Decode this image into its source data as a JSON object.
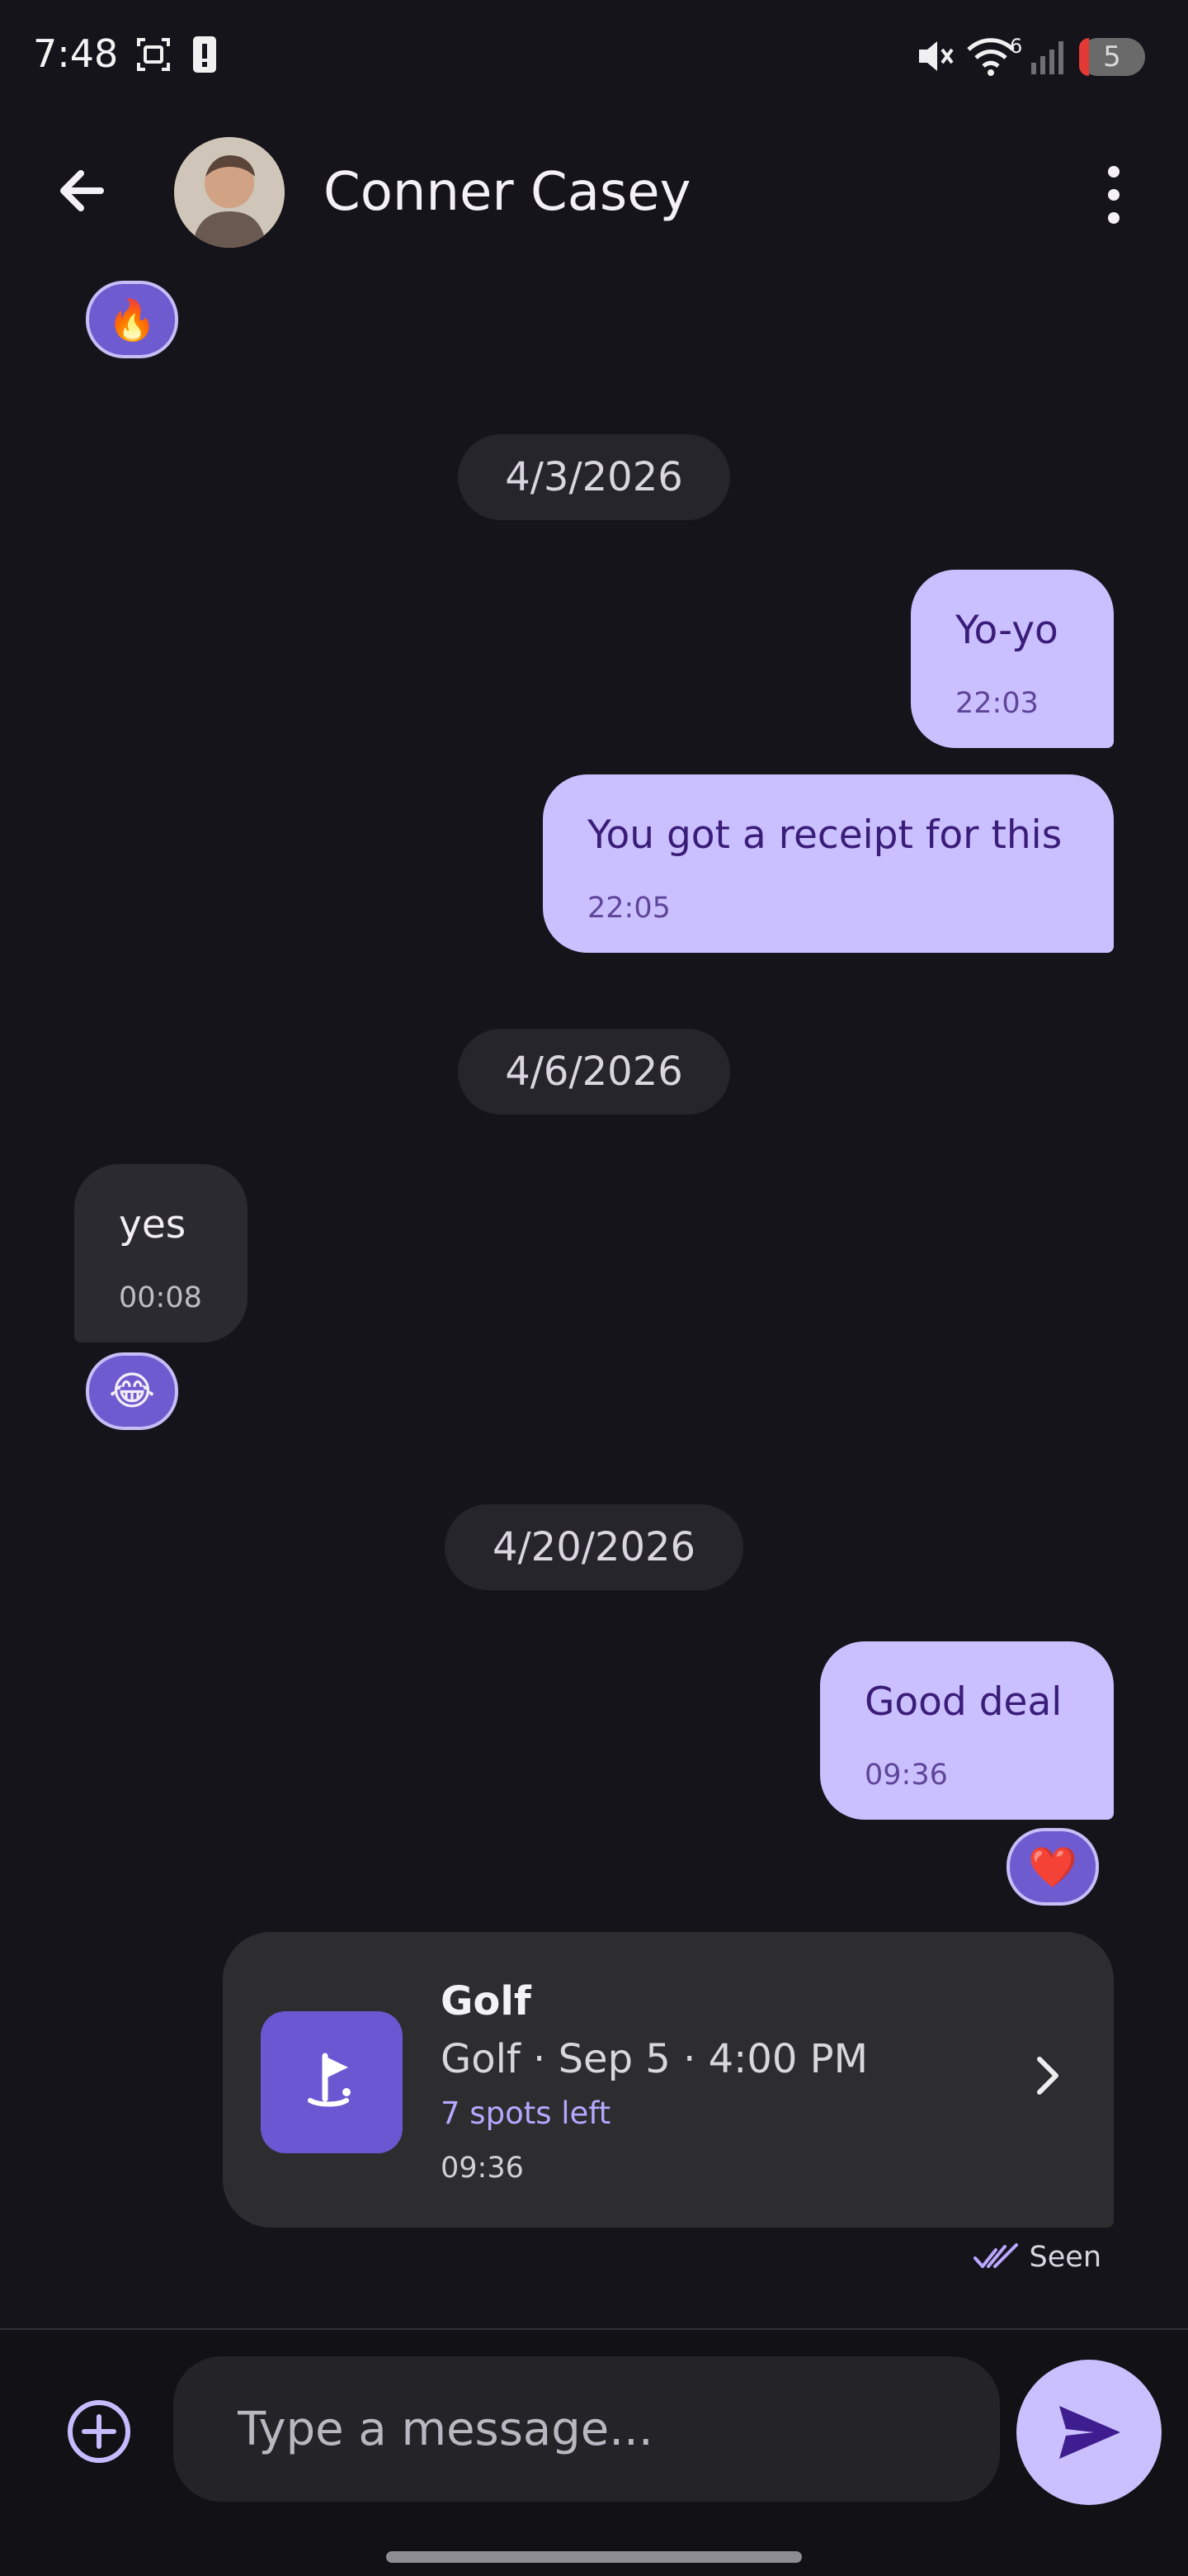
{
  "status_bar": {
    "time": "7:48",
    "wifi_label": "6",
    "battery_level": "5"
  },
  "header": {
    "contact_name": "Conner Casey",
    "back_icon": "arrow-left-icon",
    "menu_icon": "more-vert-icon"
  },
  "messages": {
    "top_reaction": "🔥",
    "date_1": "4/3/2026",
    "out_1": {
      "text": "Yo-yo",
      "time": "22:03"
    },
    "out_2": {
      "text": "You got a receipt for this",
      "time": "22:05"
    },
    "date_2": "4/6/2026",
    "in_1": {
      "text": "yes",
      "time": "00:08",
      "reaction": "😂"
    },
    "date_3": "4/20/2026",
    "out_3": {
      "text": "Good deal",
      "time": "09:36",
      "reaction": "❤️"
    }
  },
  "event_card": {
    "title": "Golf",
    "subtitle": "Golf · Sep 5 · 4:00 PM",
    "spots": "7 spots left",
    "time": "09:36",
    "icon": "golf-flag-icon"
  },
  "seen": {
    "label": "Seen"
  },
  "composer": {
    "placeholder": "Type a message...",
    "add_icon": "plus-circle-icon",
    "send_icon": "send-icon"
  },
  "colors": {
    "background": "#15141b",
    "outgoing_bubble": "#cbc0ff",
    "incoming_bubble": "#2b2a30",
    "accent": "#6f5bd0"
  }
}
